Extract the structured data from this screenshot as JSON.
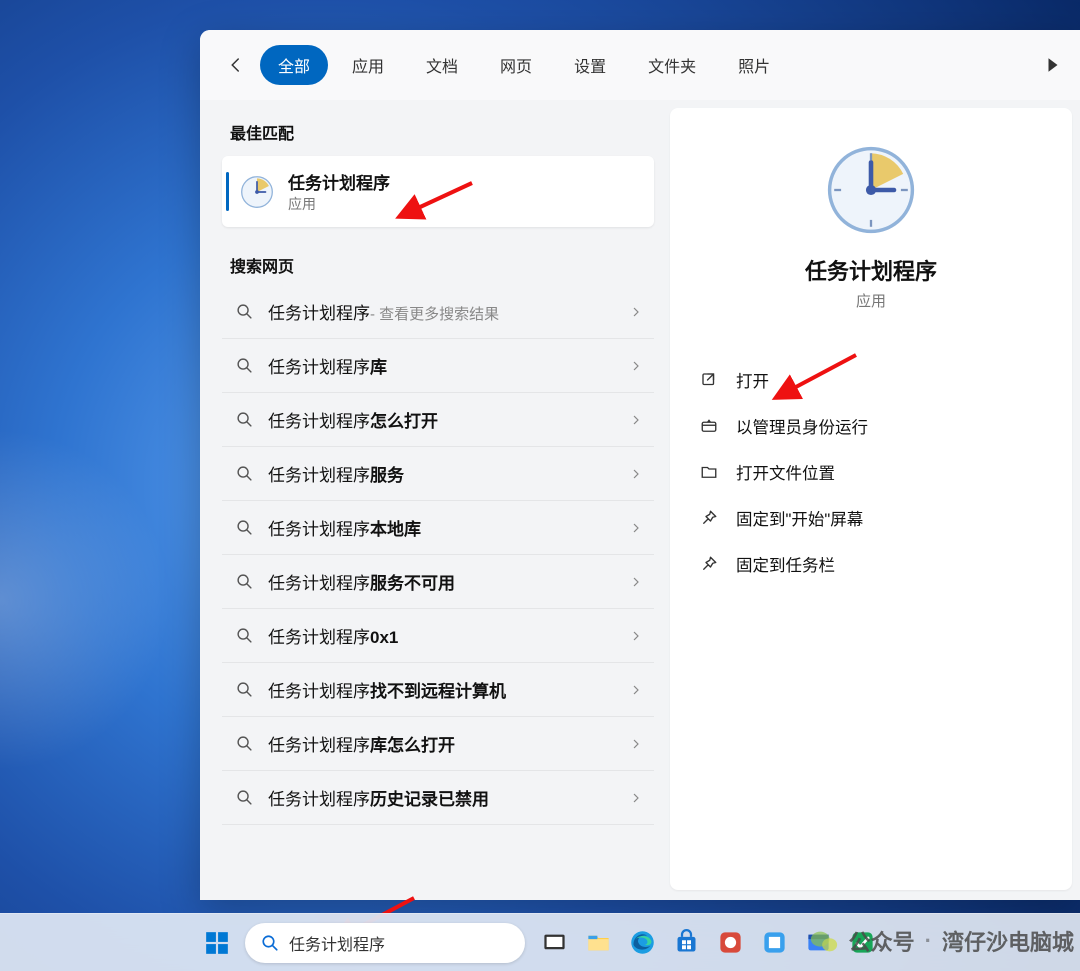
{
  "header": {
    "tabs": [
      "全部",
      "应用",
      "文档",
      "网页",
      "设置",
      "文件夹",
      "照片"
    ],
    "active_tab_index": 0
  },
  "sections": {
    "best_match_title": "最佳匹配",
    "search_web_title": "搜索网页"
  },
  "best_match": {
    "title": "任务计划程序",
    "subtitle": "应用"
  },
  "web_results": [
    {
      "prefix": "任务计划程序",
      "bold": "",
      "suffix": " - 查看更多搜索结果"
    },
    {
      "prefix": "任务计划程序",
      "bold": "库",
      "suffix": ""
    },
    {
      "prefix": "任务计划程序",
      "bold": "怎么打开",
      "suffix": ""
    },
    {
      "prefix": "任务计划程序",
      "bold": "服务",
      "suffix": ""
    },
    {
      "prefix": "任务计划程序",
      "bold": "本地库",
      "suffix": ""
    },
    {
      "prefix": "任务计划程序",
      "bold": "服务不可用",
      "suffix": ""
    },
    {
      "prefix": "任务计划程序 ",
      "bold": "0x1",
      "suffix": ""
    },
    {
      "prefix": "任务计划程序",
      "bold": "找不到远程计算机",
      "suffix": ""
    },
    {
      "prefix": "任务计划程序",
      "bold": "库怎么打开",
      "suffix": ""
    },
    {
      "prefix": "任务计划程序 ",
      "bold": "历史记录已禁用",
      "suffix": ""
    }
  ],
  "detail": {
    "title": "任务计划程序",
    "subtitle": "应用",
    "actions": [
      {
        "icon": "open",
        "label": "打开"
      },
      {
        "icon": "admin",
        "label": "以管理员身份运行"
      },
      {
        "icon": "folder",
        "label": "打开文件位置"
      },
      {
        "icon": "pin",
        "label": "固定到\"开始\"屏幕"
      },
      {
        "icon": "pin",
        "label": "固定到任务栏"
      }
    ]
  },
  "taskbar": {
    "search_value": "任务计划程序"
  },
  "watermark": {
    "prefix": "公众号",
    "name": "湾仔沙电脑城"
  }
}
